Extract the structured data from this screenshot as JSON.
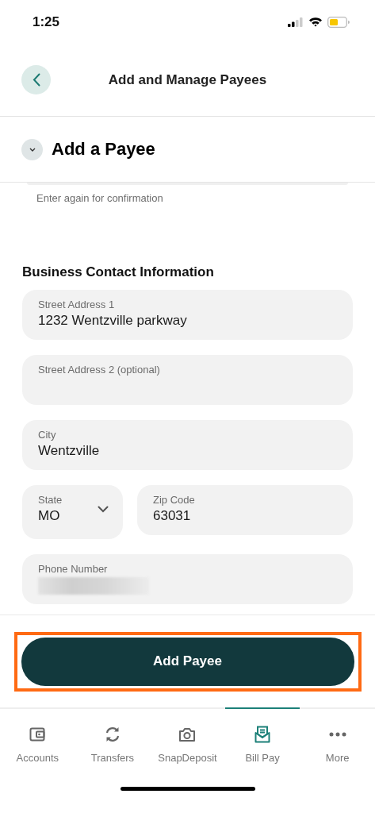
{
  "status_bar": {
    "time": "1:25"
  },
  "header": {
    "title": "Add and Manage Payees"
  },
  "section": {
    "title": "Add a Payee",
    "expanded": true
  },
  "previous_field": {
    "partial": true,
    "hint": "Enter again for confirmation"
  },
  "contact": {
    "heading": "Business Contact Information",
    "fields": [
      {
        "kind": "text",
        "label": "Street Address 1",
        "value": "1232 Wentzville parkway"
      },
      {
        "kind": "text",
        "label": "Street Address 2 (optional)"
      },
      {
        "kind": "text",
        "label": "City",
        "value": "Wentzville"
      },
      {
        "kind": "select",
        "label": "State",
        "value": "MO"
      },
      {
        "kind": "text",
        "label": "Zip Code",
        "value": "63031"
      },
      {
        "kind": "text",
        "label": "Phone Number",
        "redacted": true
      }
    ]
  },
  "action": {
    "label": "Add Payee",
    "highlighted": true
  },
  "tabs": [
    {
      "label": "Accounts",
      "selected": false
    },
    {
      "label": "Transfers",
      "selected": false
    },
    {
      "label": "SnapDeposit",
      "selected": false
    },
    {
      "label": "Bill Pay",
      "selected": true
    },
    {
      "label": "More",
      "selected": false
    }
  ]
}
